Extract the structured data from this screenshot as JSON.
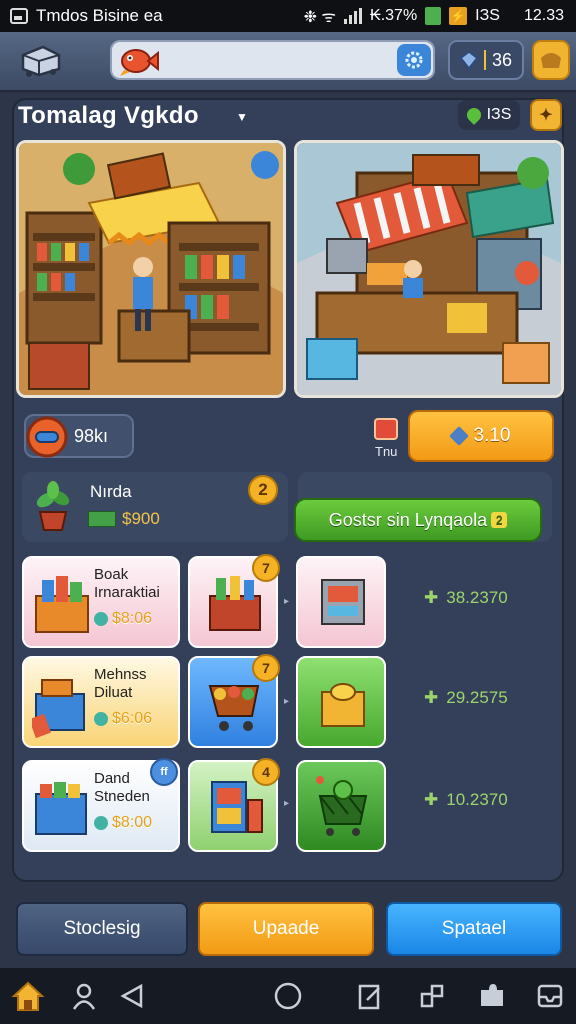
{
  "status_bar": {
    "app_title": "Tmdos Bisine ea",
    "signal_text": "❉ ᯤ",
    "battery_text": "₭.37%",
    "counter": "ΙЗS",
    "time": "12.33"
  },
  "top_bar": {
    "gem_count": "36"
  },
  "header": {
    "title": "Tomalag Vgkdo",
    "level_value": "ΙЗS"
  },
  "trade": {
    "coin_amount": "98kı",
    "small_label": "Tnu",
    "buy_price": "3.10"
  },
  "npc": {
    "name": "Nırda",
    "price": "$900",
    "badge": "2",
    "upgrade_label": "Gostsr sin Lynqaola",
    "upgrade_lock": "2"
  },
  "rows": [
    {
      "title": "Boak\nIrnaraktiai",
      "price": "$8:06",
      "badge": "7",
      "value": "38.2370",
      "theme": "pink"
    },
    {
      "title": "Mehnss\nDiluat",
      "price": "$6:06",
      "badge": "7",
      "value": "29.2575",
      "theme": "yellow"
    },
    {
      "title": "Dand\nStneden",
      "price": "$8:00",
      "badge": "4",
      "corner": "ff",
      "value": "10.2370",
      "theme": "white"
    }
  ],
  "actions": {
    "left": "Stoclesig",
    "middle": "Upaade",
    "right": "Spatael"
  },
  "colors": {
    "panel": "#34405a",
    "accent_orange": "#f29a15",
    "accent_green": "#3e9a22",
    "accent_blue": "#1a86e6"
  },
  "icons": {
    "logo": "forklift-icon",
    "search": "fish-icon",
    "gear": "gear-icon",
    "gem": "gem-icon",
    "bag": "bag-icon",
    "nav": [
      "home-icon",
      "person-icon",
      "back-icon",
      "home-circle-icon",
      "edit-icon",
      "share-icon",
      "puzzle-icon",
      "inbox-icon"
    ]
  }
}
